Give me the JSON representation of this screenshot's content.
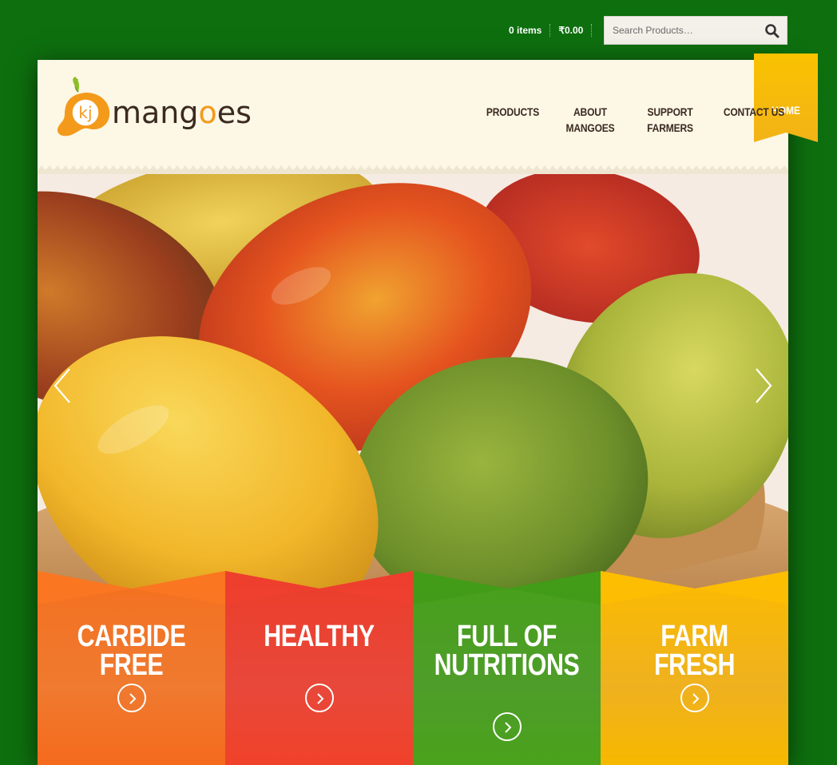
{
  "cart": {
    "items_label": "0 items",
    "total_label": "₹0.00"
  },
  "search": {
    "placeholder": "Search Products…"
  },
  "brand": {
    "logo_initials": "kj",
    "logo_word_start": "mang",
    "logo_word_o": "o",
    "logo_word_end": "es"
  },
  "nav": {
    "home": "HOME",
    "products": "PRODUCTS",
    "about_line1": "ABOUT",
    "about_line2": "MANGOES",
    "support_line1": "SUPPORT",
    "support_line2": "FARMERS",
    "contact": "CONTACT US"
  },
  "features": [
    {
      "line1": "CARBIDE FREE",
      "line2": "",
      "color": "#f4701f"
    },
    {
      "line1": "HEALTHY",
      "line2": "",
      "color": "#e53d2b"
    },
    {
      "line1": "FULL OF",
      "line2": "NUTRITIONS",
      "color": "#4a9e1c"
    },
    {
      "line1": "FARM FRESH",
      "line2": "",
      "color": "#f6b40a"
    }
  ],
  "colors": {
    "page_bg": "#0e6f0e",
    "panel_bg": "#fdf7e6",
    "accent_yellow": "#f7b718",
    "text_dark": "#3a2a20",
    "logo_orange": "#f39a1b"
  }
}
